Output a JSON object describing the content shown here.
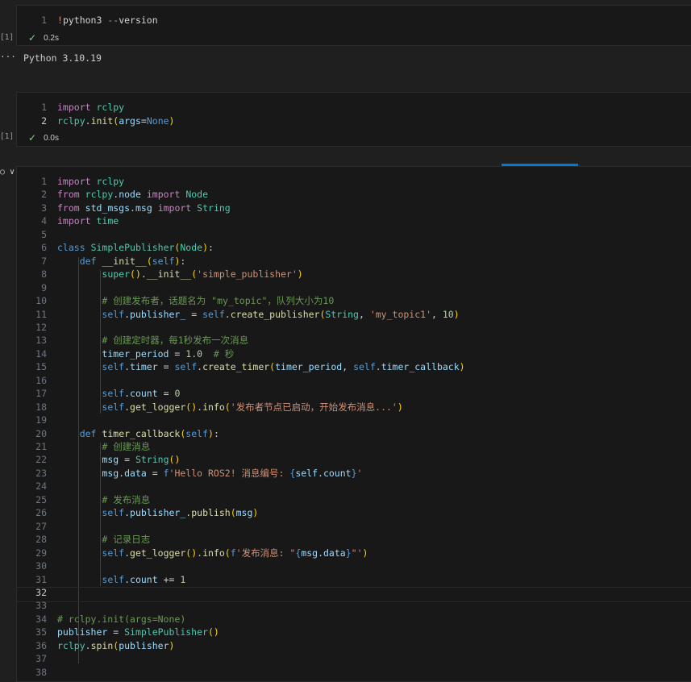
{
  "cells": [
    {
      "exec_count": "[1]",
      "lines": [
        {
          "n": "1",
          "text": "!python3 --version"
        }
      ],
      "status_time": "0.2s",
      "output": "Python 3.10.19"
    },
    {
      "exec_count": "[1]",
      "lines": [
        {
          "n": "1",
          "text": "import rclpy"
        },
        {
          "n": "2",
          "text": "rclpy.init(args=None)"
        }
      ],
      "status_time": "0.0s"
    },
    {
      "lines": [
        {
          "n": "1",
          "text": "import rclpy"
        },
        {
          "n": "2",
          "text": "from rclpy.node import Node"
        },
        {
          "n": "3",
          "text": "from std_msgs.msg import String"
        },
        {
          "n": "4",
          "text": "import time"
        },
        {
          "n": "5",
          "text": ""
        },
        {
          "n": "6",
          "text": "class SimplePublisher(Node):"
        },
        {
          "n": "7",
          "text": "    def __init__(self):"
        },
        {
          "n": "8",
          "text": "        super().__init__('simple_publisher')"
        },
        {
          "n": "9",
          "text": ""
        },
        {
          "n": "10",
          "text": "        # 创建发布者，话题名为 \"my_topic\"，队列大小为10"
        },
        {
          "n": "11",
          "text": "        self.publisher_ = self.create_publisher(String, 'my_topic1', 10)"
        },
        {
          "n": "12",
          "text": ""
        },
        {
          "n": "13",
          "text": "        # 创建定时器，每1秒发布一次消息"
        },
        {
          "n": "14",
          "text": "        timer_period = 1.0  # 秒"
        },
        {
          "n": "15",
          "text": "        self.timer = self.create_timer(timer_period, self.timer_callback)"
        },
        {
          "n": "16",
          "text": ""
        },
        {
          "n": "17",
          "text": "        self.count = 0"
        },
        {
          "n": "18",
          "text": "        self.get_logger().info('发布者节点已启动，开始发布消息...')"
        },
        {
          "n": "19",
          "text": ""
        },
        {
          "n": "20",
          "text": "    def timer_callback(self):"
        },
        {
          "n": "21",
          "text": "        # 创建消息"
        },
        {
          "n": "22",
          "text": "        msg = String()"
        },
        {
          "n": "23",
          "text": "        msg.data = f'Hello ROS2! 消息编号: {self.count}'"
        },
        {
          "n": "24",
          "text": ""
        },
        {
          "n": "25",
          "text": "        # 发布消息"
        },
        {
          "n": "26",
          "text": "        self.publisher_.publish(msg)"
        },
        {
          "n": "27",
          "text": ""
        },
        {
          "n": "28",
          "text": "        # 记录日志"
        },
        {
          "n": "29",
          "text": "        self.get_logger().info(f'发布消息: \"{msg.data}\"')"
        },
        {
          "n": "30",
          "text": ""
        },
        {
          "n": "31",
          "text": "        self.count += 1"
        },
        {
          "n": "32",
          "text": ""
        },
        {
          "n": "33",
          "text": ""
        },
        {
          "n": "34",
          "text": "# rclpy.init(args=None)"
        },
        {
          "n": "35",
          "text": "publisher = SimplePublisher()"
        },
        {
          "n": "36",
          "text": "rclpy.spin(publisher)"
        },
        {
          "n": "37",
          "text": ""
        },
        {
          "n": "38",
          "text": ""
        }
      ]
    }
  ],
  "output_dots": "···",
  "run_indicator": "○ ∨",
  "colors": {
    "background": "#1f1f1f",
    "cell_background": "#181818",
    "check": "#89d185",
    "accent": "#0078d4"
  }
}
